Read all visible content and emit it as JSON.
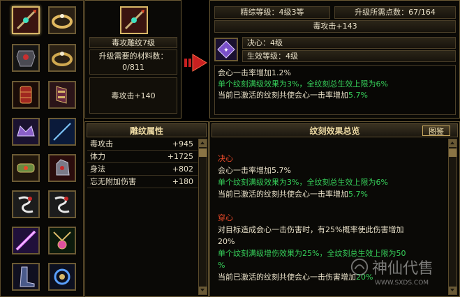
{
  "item": {
    "name": "毒攻雕纹7级",
    "materials_label": "升级需要的材料数：",
    "materials_value": "0/811",
    "attr_bonus": "毒攻击+140"
  },
  "top": {
    "level": "精综等级：4级3等",
    "points": "升级所需点数：67/164",
    "target_attr": "毒攻击+143",
    "resolve": "决心：4级",
    "effect_level": "生效等级：4级",
    "desc_1": "会心一击率增加1.2%",
    "desc_2": "单个纹刻满级效果为3%，全纹刻总生效上限为6%",
    "desc_3_prefix": "当前已激活的纹刻共使会心一击率增加",
    "desc_3_value": "5.7%"
  },
  "attrs": {
    "title": "雕纹属性",
    "rows": [
      {
        "name": "毒攻击",
        "value": "+945"
      },
      {
        "name": "体力",
        "value": "+1725"
      },
      {
        "name": "身法",
        "value": "+802"
      },
      {
        "name": "忘无附加伤害",
        "value": "+180"
      }
    ]
  },
  "summary": {
    "title": "纹刻效果总览",
    "button": "图鉴",
    "s1_title": "决心",
    "s1_l1": "会心一击率增加5.7%",
    "s1_l2": "单个纹刻满级效果为3%，全纹刻总生效上限为6%",
    "s1_l3_prefix": "当前已激活的纹刻共使会心一击率增加",
    "s1_l3_value": "5.7%",
    "s2_title": "穿心",
    "s2_l1": "对目标造成会心一击伤害时，有25%概率使此伤害增加",
    "s2_l1b": "20%",
    "s2_l2": "单个纹刻满级增伤效果为25%，全纹刻总生效上限为50",
    "s2_l2b": "%",
    "s2_l3_prefix": "当前已激活的纹刻共使会心一击伤害增加",
    "s2_l3_value": "20%"
  },
  "watermark": {
    "text": "神仙代售",
    "url": "WWW.SXDS.COM"
  },
  "colors": {
    "gold": "#d8b868",
    "red": "#e84a2a",
    "green": "#36d05a",
    "frame": "#6b5a34"
  },
  "icons": [
    "spear-icon",
    "ring-icon",
    "armor-icon",
    "ring-icon",
    "bracer-icon",
    "needle-icon",
    "crown-icon",
    "gauntlet-icon",
    "tassel-icon",
    "tassel-icon",
    "blade-icon",
    "pendant-icon",
    "boots-icon",
    "ornament-icon"
  ]
}
